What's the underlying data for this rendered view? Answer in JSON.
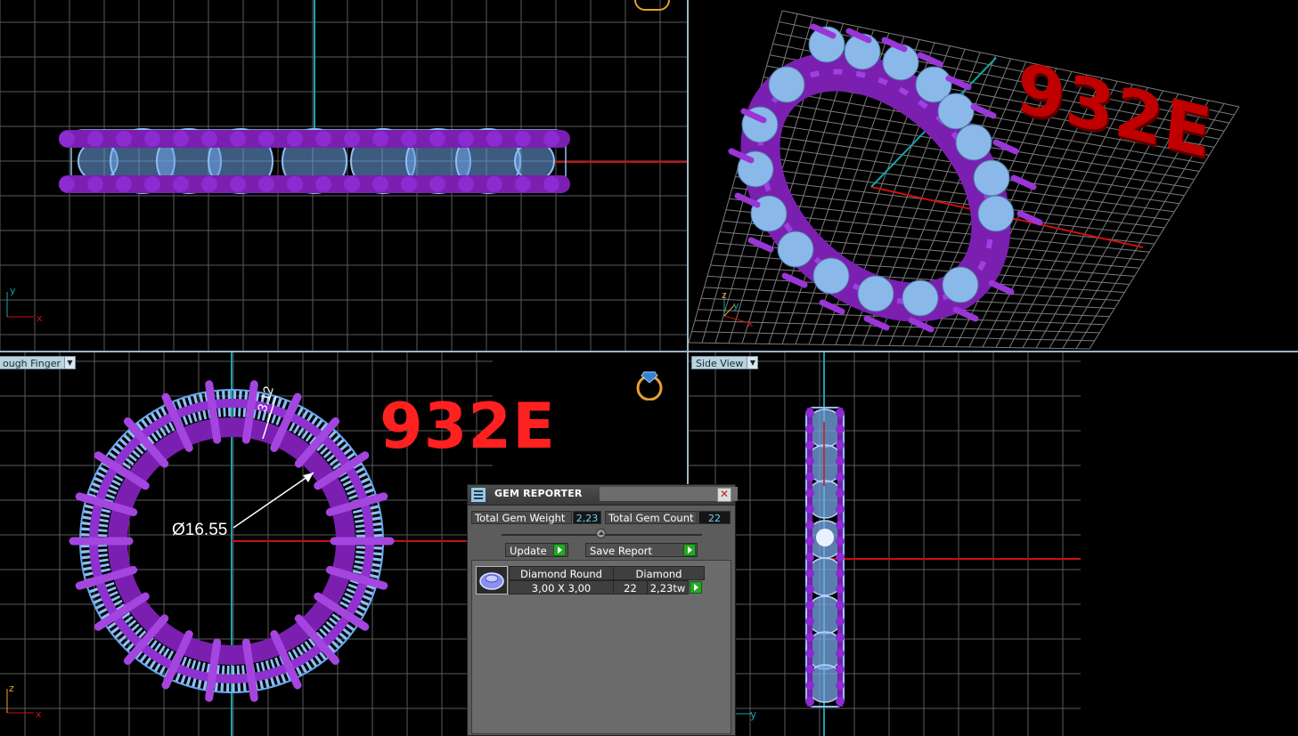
{
  "model_id": "932E",
  "colors": {
    "background": "#000000",
    "grid": "#5a5a5a",
    "metal": "#7a1fb0",
    "gem": "#8cc0f5",
    "axis_x": "#cc1010",
    "axis_y": "#17a3a8",
    "watermark": "#ff2020",
    "accent_value": "#6fd0ff"
  },
  "viewports": {
    "top_left": {
      "view": "front",
      "axis_labels": {
        "h": "x",
        "v": "y"
      }
    },
    "top_right": {
      "view": "perspective",
      "axis_labels": {
        "h": "x",
        "v": "z",
        "d": "y"
      }
    },
    "bottom_left": {
      "label": "ough Finger",
      "axis_labels": {
        "h": "x",
        "v": "z"
      },
      "dimensions": {
        "inner_diameter": "Ø16.55",
        "band_width": "3.12"
      }
    },
    "bottom_right": {
      "label": "Side View",
      "axis_labels": {
        "h": "y"
      }
    }
  },
  "icons": {
    "ring_icon": "ring-icon",
    "dropdown_arrow": "chevron-down-icon",
    "close": "close-icon",
    "play": "play-icon"
  },
  "gem_reporter": {
    "title": "GEM REPORTER",
    "total_weight_label": "Total Gem Weight",
    "total_weight_value": "2,23",
    "total_count_label": "Total Gem Count",
    "total_count_value": "22",
    "update_label": "Update",
    "save_report_label": "Save Report",
    "rows": [
      {
        "shape": "Diamond Round",
        "material": "Diamond",
        "size": "3,00 X 3,00",
        "count": "22",
        "weight": "2,23tw"
      }
    ]
  }
}
